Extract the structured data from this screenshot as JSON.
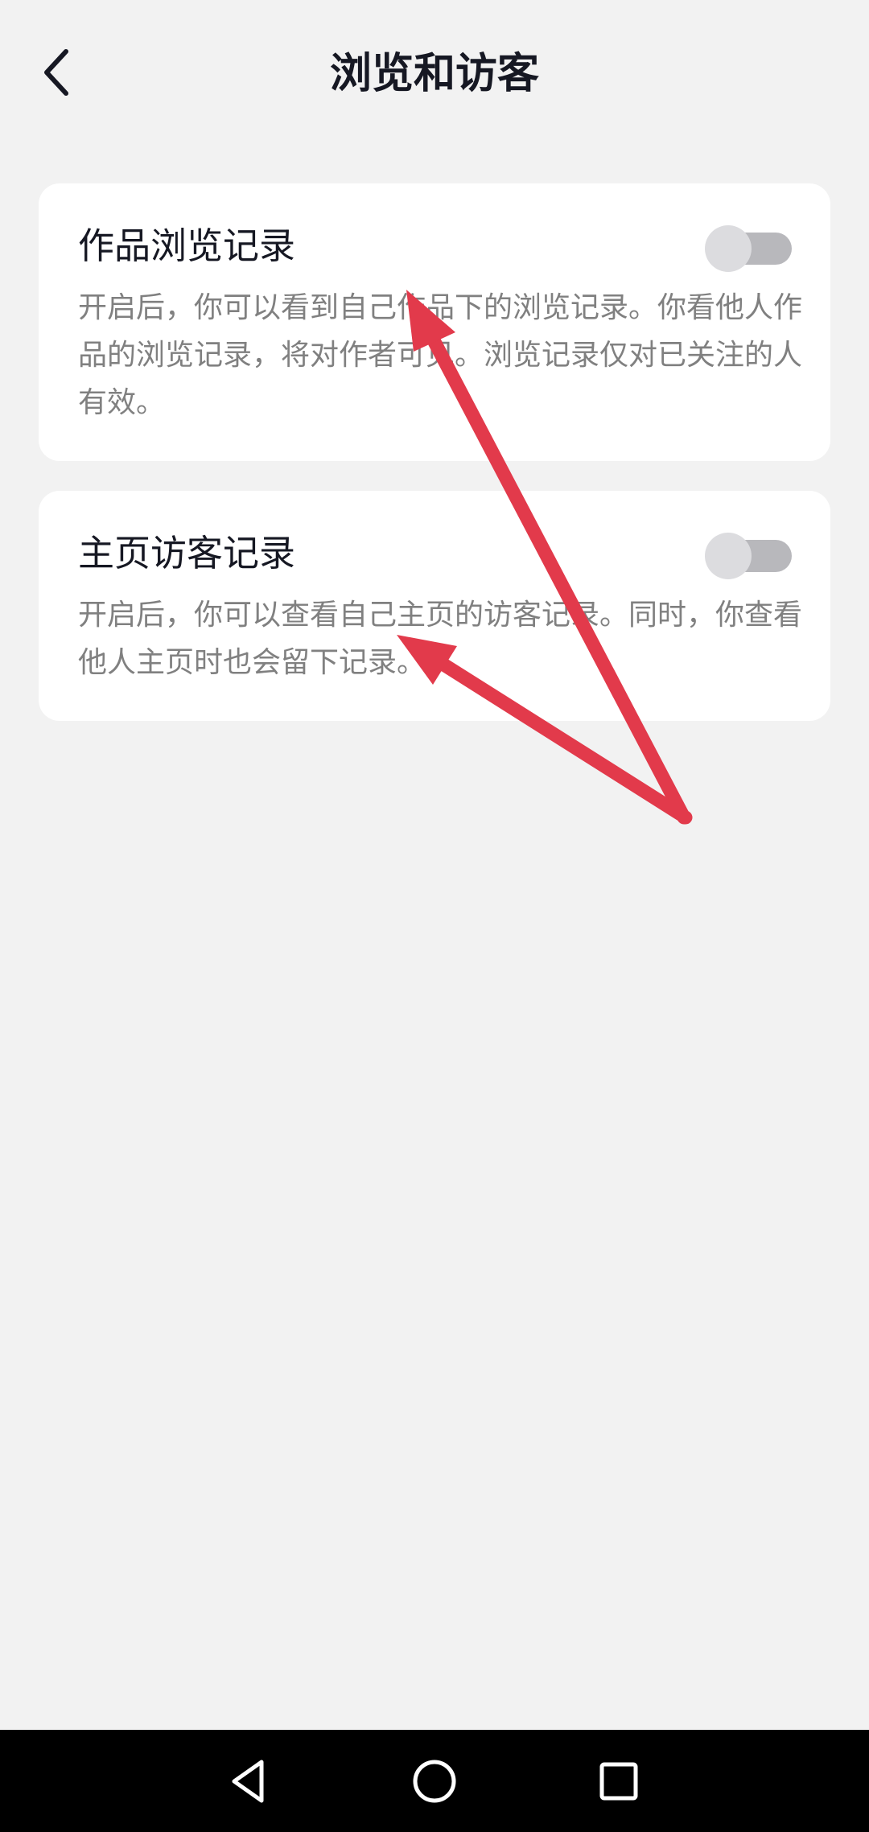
{
  "header": {
    "title": "浏览和访客",
    "back_icon": "chevron-left-icon"
  },
  "settings": [
    {
      "title": "作品浏览记录",
      "description": "开启后，你可以看到自己作品下的浏览记录。你看他人作品的浏览记录，将对作者可见。浏览记录仅对已关注的人有效。",
      "enabled": false
    },
    {
      "title": "主页访客记录",
      "description": "开启后，你可以查看自己主页的访客记录。同时，你查看他人主页时也会留下记录。",
      "enabled": false
    }
  ],
  "annotation": {
    "color": "#e23a4b",
    "shape": "two red arrows pointing to the setting descriptions"
  },
  "navbar": {
    "back_icon": "triangle-back-icon",
    "home_icon": "circle-home-icon",
    "recents_icon": "square-recents-icon"
  },
  "colors": {
    "background": "#f2f2f2",
    "card": "#ffffff",
    "title_text": "#161823",
    "description_text": "#808080",
    "toggle_off_track": "#b8b8bc",
    "toggle_off_knob": "#dcdcdf",
    "navbar": "#000000"
  }
}
